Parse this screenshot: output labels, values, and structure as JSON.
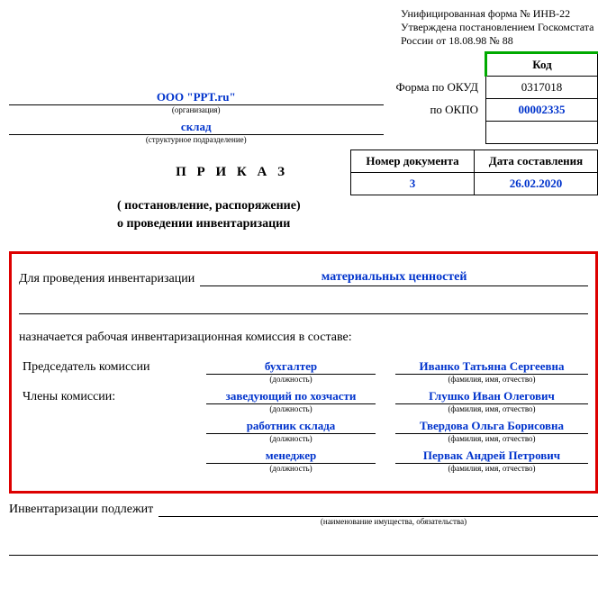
{
  "header_note": {
    "line1": "Унифицированная форма № ИНВ-22",
    "line2": "Утверждена постановлением Госкомстата",
    "line3": "России от 18.08.98 № 88"
  },
  "org": {
    "name": "ООО \"PPT.ru\"",
    "caption": "(организация)",
    "subdiv": "склад",
    "subdiv_caption": "(структурное подразделение)"
  },
  "codes": {
    "kod_header": "Код",
    "okud_label": "Форма по ОКУД",
    "okud": "0317018",
    "okpo_label": "по ОКПО",
    "okpo": "00002335"
  },
  "docnum": {
    "num_header": "Номер документа",
    "date_header": "Дата составления",
    "num": "3",
    "date": "26.02.2020"
  },
  "title": {
    "main": "П Р И К А З",
    "sub1": "( постановление, распоряжение)",
    "sub2": "о проведении инвентаризации"
  },
  "inventory": {
    "lead": "Для проведения инвентаризации",
    "value": "материальных ценностей"
  },
  "appoint_text": "назначается рабочая инвентаризационная комиссия в составе:",
  "commission": {
    "chair_label": "Председатель комиссии",
    "members_label": "Члены комиссии:",
    "pos_caption": "(должность)",
    "name_caption": "(фамилия, имя, отчество)",
    "rows": [
      {
        "pos": "бухгалтер",
        "name": "Иванко Татьяна Сергеевна"
      },
      {
        "pos": "заведующий по хозчасти",
        "name": "Глушко Иван Олегович"
      },
      {
        "pos": "работник склада",
        "name": "Твердова Ольга Борисовна"
      },
      {
        "pos": "менеджер",
        "name": "Первак Андрей Петрович"
      }
    ]
  },
  "subject": {
    "lead": "Инвентаризации подлежит",
    "caption": "(наименование имущества, обязательства)"
  }
}
